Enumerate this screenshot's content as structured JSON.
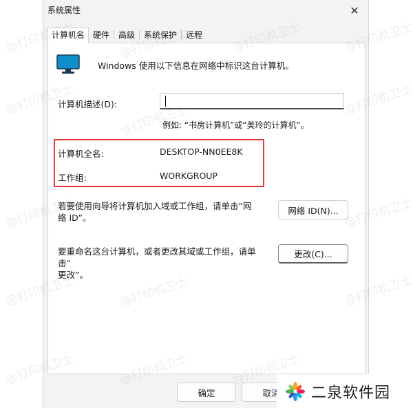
{
  "window": {
    "title": "系统属性",
    "close_glyph": "✕"
  },
  "tabs": [
    {
      "label": "计算机名",
      "active": true
    },
    {
      "label": "硬件"
    },
    {
      "label": "高级"
    },
    {
      "label": "系统保护"
    },
    {
      "label": "远程"
    }
  ],
  "panel": {
    "intro": "Windows 使用以下信息在网络中标识这台计算机。",
    "description_label": "计算机描述(D):",
    "description_value": "",
    "example": "例如: “书房计算机”或“美玲的计算机”。",
    "full_name_label": "计算机全名:",
    "full_name_value": "DESKTOP-NN0EE8K",
    "workgroup_label": "工作组:",
    "workgroup_value": "WORKGROUP",
    "network_help_line1": "若要使用向导将计算机加入域或工作组，请单击“网",
    "network_help_line2": "络 ID”。",
    "network_id_button": "网络 ID(N)...",
    "rename_help_line1": "要重命名这台计算机，或者更改其域或工作组，请单击“",
    "rename_help_line2": "更改”。",
    "change_button": "更改(C)..."
  },
  "footer": {
    "ok_button": "确定",
    "cancel_button": "取消"
  },
  "watermark": {
    "text": "@打印机卫士"
  },
  "brand": {
    "name": "二泉软件园"
  },
  "colors": {
    "highlight_border": "#e53935",
    "monitor_screen": "#0e8fc9"
  }
}
